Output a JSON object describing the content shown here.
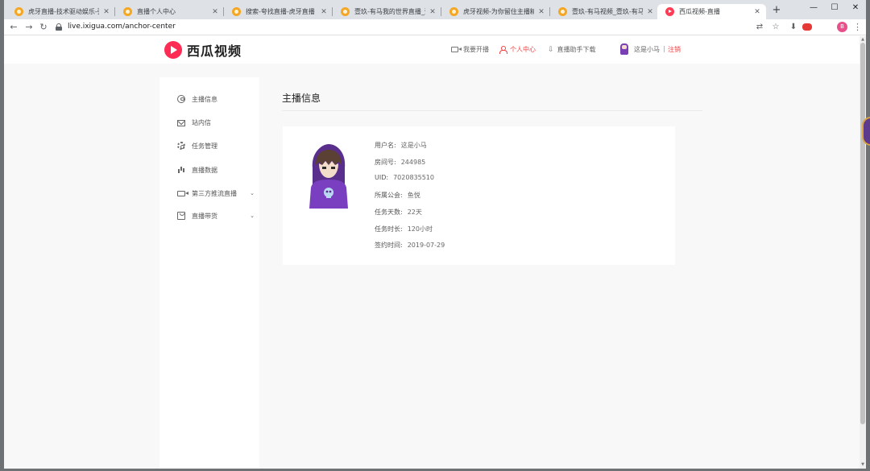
{
  "browser": {
    "tabs": [
      {
        "title": "虎牙直播-技术驱动娱乐-弹幕式互",
        "favicon": "huya-icon",
        "active": false
      },
      {
        "title": "直播个人中心",
        "favicon": "huya-icon",
        "active": false
      },
      {
        "title": "搜索-夸找直播-虎牙直播",
        "favicon": "huya-icon",
        "active": false
      },
      {
        "title": "壹玖-有马我的世界直播_壹玖-有",
        "favicon": "huya-icon",
        "active": false
      },
      {
        "title": "虎牙视频-为你留住主播精彩时刻",
        "favicon": "huya-icon",
        "active": false
      },
      {
        "title": "壹玖-有马视频_壹玖-有马直播视",
        "favicon": "huya-icon",
        "active": false
      },
      {
        "title": "西瓜视频-直播",
        "favicon": "xigua-icon",
        "active": true
      }
    ],
    "tab_close": "✕",
    "new_tab": "+",
    "window_controls": {
      "minimize": "—",
      "maximize": "☐",
      "close": "✕"
    },
    "url": "live.ixigua.com/anchor-center",
    "profile_initial": "B"
  },
  "site": {
    "logo_text": "西瓜视频",
    "nav": {
      "go_live": "我要开播",
      "personal_center": "个人中心",
      "assistant_download": "直播助手下载",
      "user_name": "这是小马",
      "separator": "|",
      "logout": "注销"
    },
    "sidebar": [
      {
        "label": "主播信息",
        "icon": "user-circle-icon"
      },
      {
        "label": "站内信",
        "icon": "mail-icon"
      },
      {
        "label": "任务管理",
        "icon": "gear-icon"
      },
      {
        "label": "直播数据",
        "icon": "bar-chart-icon"
      },
      {
        "label": "第三方推流直播",
        "icon": "video-camera-icon",
        "chevron": "⌄"
      },
      {
        "label": "直播带货",
        "icon": "shopping-bag-icon",
        "chevron": "⌄"
      }
    ],
    "main": {
      "title": "主播信息",
      "info": [
        {
          "label": "用户名:",
          "value": "这是小马"
        },
        {
          "label": "房间号:",
          "value": "244985"
        },
        {
          "label": "UID:",
          "value": "7020835510"
        },
        {
          "label": "所属公会:",
          "value": "鱼悦"
        },
        {
          "label": "任务天数:",
          "value": "22天"
        },
        {
          "label": "任务时长:",
          "value": "120小时"
        },
        {
          "label": "签约时间:",
          "value": "2019-07-29"
        }
      ]
    }
  },
  "colors": {
    "accent": "#f04142",
    "brand": "#fe2c55",
    "page_bg": "#f8f8f8"
  }
}
